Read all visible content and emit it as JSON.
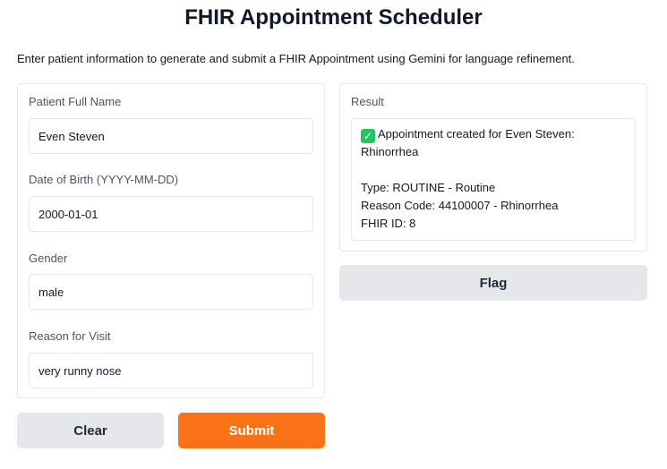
{
  "header": {
    "title": "FHIR Appointment Scheduler",
    "subtitle": "Enter patient information to generate and submit a FHIR Appointment using Gemini for language refinement."
  },
  "form": {
    "name_label": "Patient Full Name",
    "name_value": "Even Steven",
    "dob_label": "Date of Birth (YYYY-MM-DD)",
    "dob_value": "2000-01-01",
    "gender_label": "Gender",
    "gender_value": "male",
    "reason_label": "Reason for Visit",
    "reason_value": "very runny nose"
  },
  "result": {
    "label": "Result",
    "icon": "check-icon",
    "line1": "Appointment created for Even Steven:",
    "line2": "Rhinorrhea",
    "line3": "Type: ROUTINE - Routine",
    "line4": "Reason Code: 44100007 - Rhinorrhea",
    "line5": "FHIR ID: 8"
  },
  "buttons": {
    "clear_label": "Clear",
    "submit_label": "Submit",
    "flag_label": "Flag"
  },
  "colors": {
    "accent": "#f97316",
    "secondary_button": "#e5e7eb",
    "success": "#22c55e"
  }
}
